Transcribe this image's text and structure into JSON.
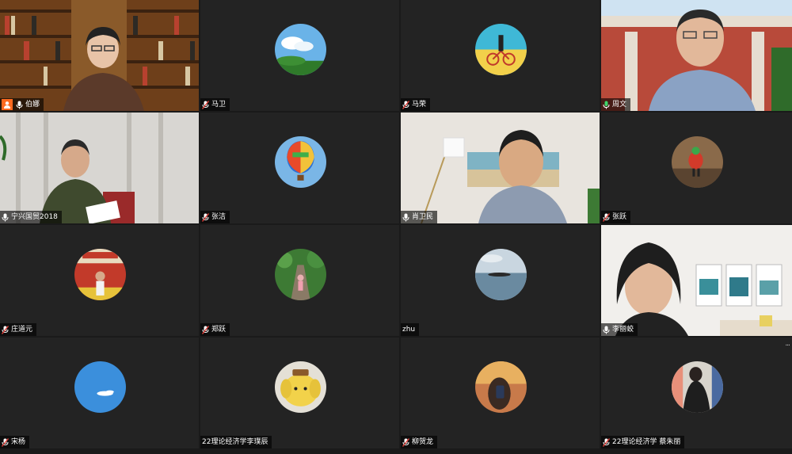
{
  "meeting": {
    "participants": [
      {
        "name": "伯娜",
        "mic": "on",
        "host": true,
        "video": true
      },
      {
        "name": "马卫",
        "mic": "muted"
      },
      {
        "name": "马荣",
        "mic": "muted"
      },
      {
        "name": "周文",
        "mic": "on",
        "video": true
      },
      {
        "name": "宁兴国贸2018",
        "mic": "on",
        "video": true
      },
      {
        "name": "张洁",
        "mic": "muted"
      },
      {
        "name": "肖卫民",
        "mic": "on",
        "video": true
      },
      {
        "name": "张跃",
        "mic": "muted"
      },
      {
        "name": "庄道元",
        "mic": "muted"
      },
      {
        "name": "郑跃",
        "mic": "muted"
      },
      {
        "name": "zhu",
        "mic": "none"
      },
      {
        "name": "李丽蛟",
        "mic": "on",
        "video": true
      },
      {
        "name": "宋杨",
        "mic": "muted"
      },
      {
        "name": "22理论经济学李璞辰",
        "mic": "none"
      },
      {
        "name": "柳贺龙",
        "mic": "muted"
      },
      {
        "name": "22理论经济学 蔡朱丽",
        "mic": "muted"
      }
    ],
    "more_indicator": "..."
  },
  "colors": {
    "tile_bg": "#232323",
    "host_badge": "#ff6a1f",
    "mic_on": "#ffffff",
    "mic_muted": "#e0403a"
  }
}
